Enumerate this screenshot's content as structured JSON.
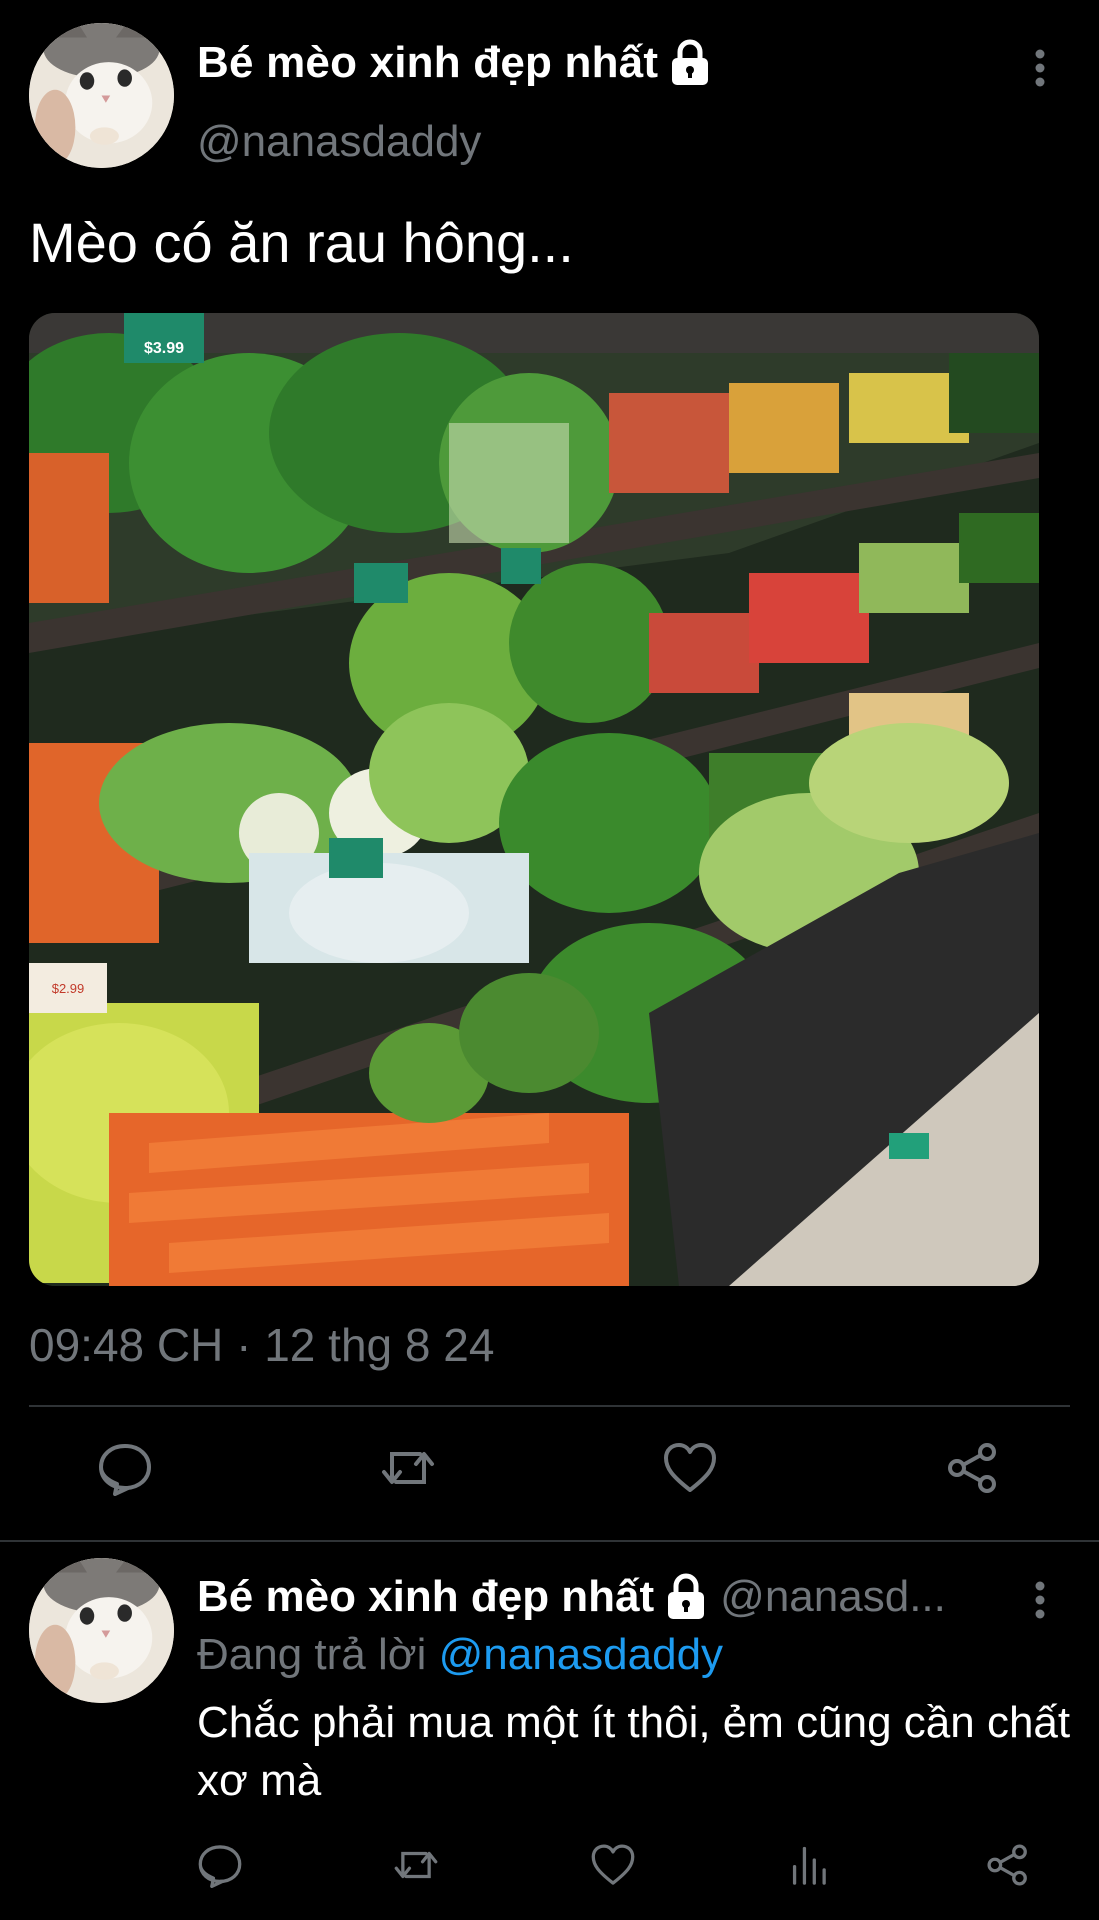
{
  "tweet": {
    "author_name": "Bé mèo xinh đẹp nhất",
    "handle": "@nanasdaddy",
    "text": "Mèo có ăn rau hông...",
    "timestamp": "09:48 CH · 12 thg 8 24",
    "media": {
      "price_labels": [
        "$3.99",
        "$2.99"
      ]
    },
    "icons": {
      "lock": "lock-icon",
      "more": "more-vertical-icon",
      "reply": "reply-icon",
      "retweet": "retweet-icon",
      "like": "like-icon",
      "share": "share-icon"
    }
  },
  "reply": {
    "author_name": "Bé mèo xinh đẹp nhất",
    "handle": "@nanasd...",
    "replying_prefix": "Đang trả lời",
    "replying_to": "@nanasdaddy",
    "text": "Chắc phải mua một ít thôi, ẻm cũng cần chất xơ mà",
    "icons": {
      "reply": "reply-icon",
      "retweet": "retweet-icon",
      "like": "like-icon",
      "views": "views-icon",
      "share": "share-icon"
    }
  },
  "colors": {
    "background": "#000000",
    "text_primary": "#ffffff",
    "text_secondary": "#71767b",
    "accent": "#1d9bf0",
    "divider": "#2f3336"
  }
}
